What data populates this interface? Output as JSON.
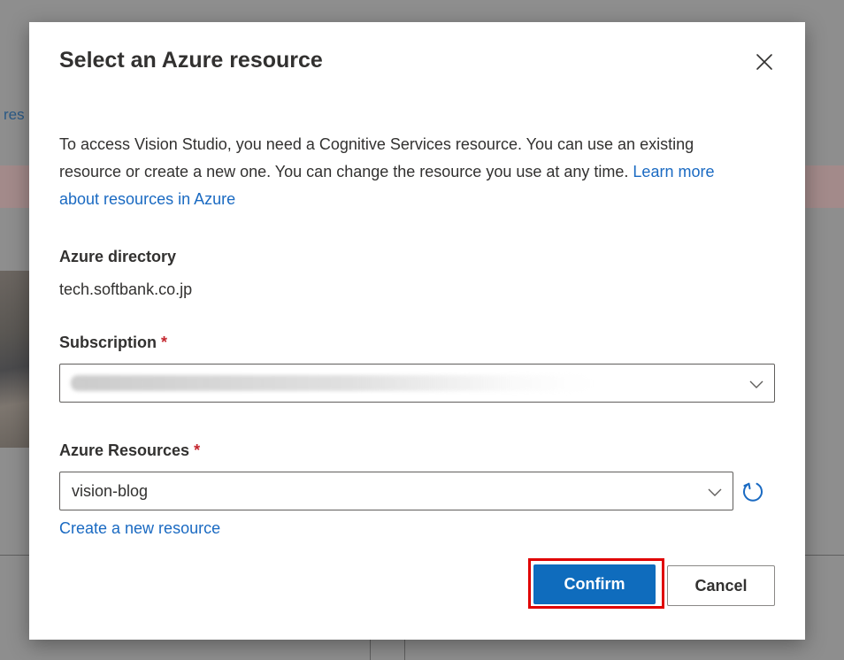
{
  "background": {
    "partial_link_text": "res"
  },
  "dialog": {
    "title": "Select an Azure resource",
    "close_icon": "close-icon",
    "description": "To access Vision Studio, you need a Cognitive Services resource. You can use an existing resource or create a new one. You can change the resource you use at any time.",
    "learn_more_link": "Learn more about resources in Azure",
    "directory": {
      "label": "Azure directory",
      "value": "tech.softbank.co.jp"
    },
    "subscription": {
      "label": "Subscription",
      "required_marker": "*",
      "selected_value": "",
      "icon": "chevron-down-icon"
    },
    "resources": {
      "label": "Azure Resources",
      "required_marker": "*",
      "selected_value": "vision-blog",
      "icon": "chevron-down-icon",
      "refresh_icon": "refresh-icon"
    },
    "create_link": "Create a new resource",
    "buttons": {
      "confirm": "Confirm",
      "cancel": "Cancel"
    },
    "colors": {
      "primary": "#0f6cbd",
      "link": "#1a6ac2",
      "required": "#c4262e",
      "highlight": "#e00000"
    }
  }
}
